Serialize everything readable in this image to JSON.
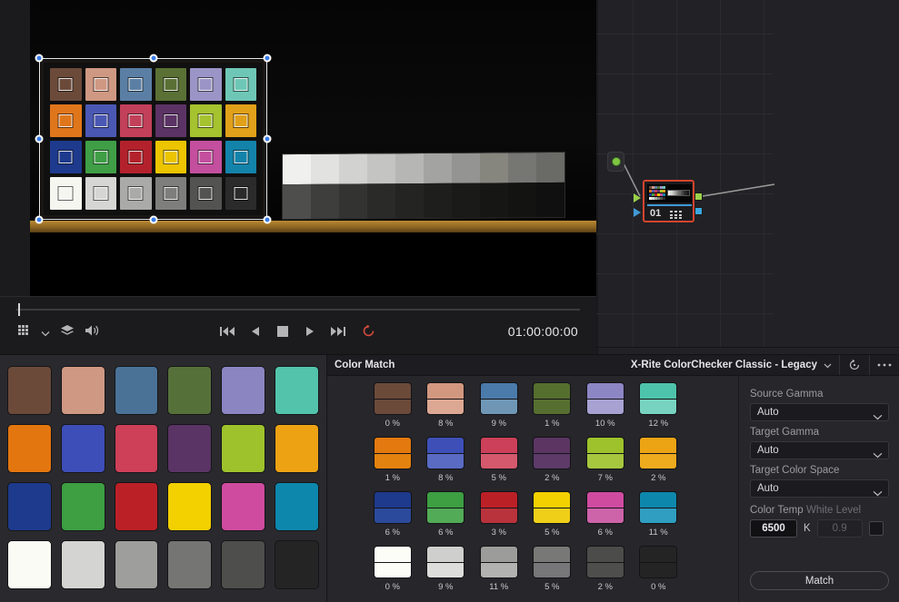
{
  "viewer": {
    "timecode": "01:00:00:00",
    "toolbar_icons": [
      "chart-grid-icon",
      "chevron-down-icon",
      "layers-icon",
      "speaker-icon"
    ],
    "transport_icons": [
      "skip-to-start-icon",
      "step-back-icon",
      "stop-icon",
      "play-icon",
      "skip-to-end-icon",
      "loop-icon"
    ],
    "chart_patch_colors": [
      "#6b4a3a",
      "#cf9883",
      "#5b7fa4",
      "#5a7035",
      "#9b94c6",
      "#6ec7b6",
      "#e0761b",
      "#4a58b4",
      "#c2405a",
      "#5c3365",
      "#a5c22f",
      "#e0a019",
      "#1e3a8c",
      "#3f9e46",
      "#b3222c",
      "#ecc400",
      "#c34f9e",
      "#1383aa",
      "#f6f6f0",
      "#d6d6d4",
      "#aaaaa8",
      "#7e7e7c",
      "#535351",
      "#2b2b2b"
    ],
    "wedge_top_steps": [
      "#f0f0ee",
      "#e2e2e0",
      "#d2d2d0",
      "#c4c4c2",
      "#b6b6b4",
      "#a3a3a1",
      "#949492",
      "#86867f",
      "#767673",
      "#6a6a67"
    ],
    "wedge_bottom_steps": [
      "#4e4e4c",
      "#3e3e3c",
      "#333331",
      "#2a2a28",
      "#242422",
      "#1e1e1c",
      "#1a1a18",
      "#161614",
      "#131311",
      "#101010"
    ]
  },
  "nodegraph": {
    "source_node_name": "source-node",
    "node": {
      "label": "01",
      "selected": true,
      "thumbnail_colors": [
        "#6b4a3a",
        "#cf9883",
        "#5b7fa4",
        "#5a7035",
        "#9b94c6",
        "#6ec7b6",
        "#e0761b",
        "#4a58b4",
        "#c2405a",
        "#5c3365",
        "#a5c22f",
        "#e0a019",
        "#1e3a8c",
        "#3f9e46",
        "#b3222c",
        "#ecc400",
        "#c34f9e",
        "#1383aa",
        "#f6f6f0",
        "#d6d6d4",
        "#aaaaa8",
        "#7e7e7c",
        "#535351",
        "#2b2b2b"
      ],
      "thumb_wedge": [
        "#f0f0ee",
        "#d8d8d6",
        "#bdbdbb",
        "#a2a2a0",
        "#858583",
        "#6a6a68",
        "#505050",
        "#3a3a3a",
        "#262626",
        "#141414"
      ]
    },
    "accent_selected": "#d4442e",
    "port_green": "#9ad14a",
    "port_blue": "#3ba7e0"
  },
  "palette": {
    "name": "reference-color-palette",
    "colors": [
      "#6b4a3a",
      "#cf9883",
      "#4a7297",
      "#56703a",
      "#8b85c2",
      "#53c3ab",
      "#e3760f",
      "#3e4eb8",
      "#cd4058",
      "#5a3464",
      "#9dc22c",
      "#eda214",
      "#1e3a8c",
      "#3d9e42",
      "#bc2027",
      "#f3d000",
      "#cf4ba0",
      "#0e87ad",
      "#fbfbf5",
      "#d4d4d2",
      "#9e9e9c",
      "#757573",
      "#4e4e4c",
      "#242424"
    ]
  },
  "match_panel": {
    "title": "Color Match",
    "preset": "X-Rite ColorChecker Classic - Legacy",
    "header_icons": [
      "reset-icon",
      "options-icon"
    ],
    "swatches": [
      {
        "top": "#6b4a3a",
        "bottom": "#6b4a3a",
        "pct": "0 %"
      },
      {
        "top": "#d2977f",
        "bottom": "#dda893",
        "pct": "8 %"
      },
      {
        "top": "#4a7baa",
        "bottom": "#6f97b5",
        "pct": "9 %"
      },
      {
        "top": "#556f2f",
        "bottom": "#566f31",
        "pct": "1 %"
      },
      {
        "top": "#8d86c4",
        "bottom": "#a8a2d2",
        "pct": "10 %"
      },
      {
        "top": "#4ec3ab",
        "bottom": "#77d3bf",
        "pct": "12 %"
      },
      {
        "top": "#e3790f",
        "bottom": "#e3820f",
        "pct": "1 %"
      },
      {
        "top": "#3e50b8",
        "bottom": "#5a6bc4",
        "pct": "8 %"
      },
      {
        "top": "#cc4059",
        "bottom": "#d4596d",
        "pct": "5 %"
      },
      {
        "top": "#5c3563",
        "bottom": "#5d3a68",
        "pct": "2 %"
      },
      {
        "top": "#9ec22c",
        "bottom": "#a7c73f",
        "pct": "7 %"
      },
      {
        "top": "#eda414",
        "bottom": "#eeab1e",
        "pct": "2 %"
      },
      {
        "top": "#1e3a8c",
        "bottom": "#2b4a9b",
        "pct": "6 %"
      },
      {
        "top": "#3d9e42",
        "bottom": "#52ab56",
        "pct": "6 %"
      },
      {
        "top": "#bc2027",
        "bottom": "#b8333c",
        "pct": "3 %"
      },
      {
        "top": "#f3d000",
        "bottom": "#f0cf19",
        "pct": "5 %"
      },
      {
        "top": "#cf4ba0",
        "bottom": "#cd63a9",
        "pct": "6 %"
      },
      {
        "top": "#0e87ad",
        "bottom": "#2f9ec0",
        "pct": "11 %"
      },
      {
        "top": "#fdfdf7",
        "bottom": "#fdfdf7",
        "pct": "0 %"
      },
      {
        "top": "#cfcfcd",
        "bottom": "#dddddb",
        "pct": "9 %"
      },
      {
        "top": "#9c9c9a",
        "bottom": "#b2b2b0",
        "pct": "11 %"
      },
      {
        "top": "#787876",
        "bottom": "#77777a",
        "pct": "5 %"
      },
      {
        "top": "#4c4c4a",
        "bottom": "#4e4e4c",
        "pct": "2 %"
      },
      {
        "top": "#242424",
        "bottom": "#242424",
        "pct": "0 %"
      }
    ],
    "settings": {
      "source_gamma_label": "Source Gamma",
      "source_gamma_value": "Auto",
      "target_gamma_label": "Target Gamma",
      "target_gamma_value": "Auto",
      "target_color_space_label": "Target Color Space",
      "target_color_space_value": "Auto",
      "color_temp_label": "Color Temp",
      "color_temp_value": "6500",
      "color_temp_unit": "K",
      "white_level_label": "White Level",
      "white_level_value": "0.9",
      "white_level_checked": false,
      "match_button": "Match"
    }
  }
}
